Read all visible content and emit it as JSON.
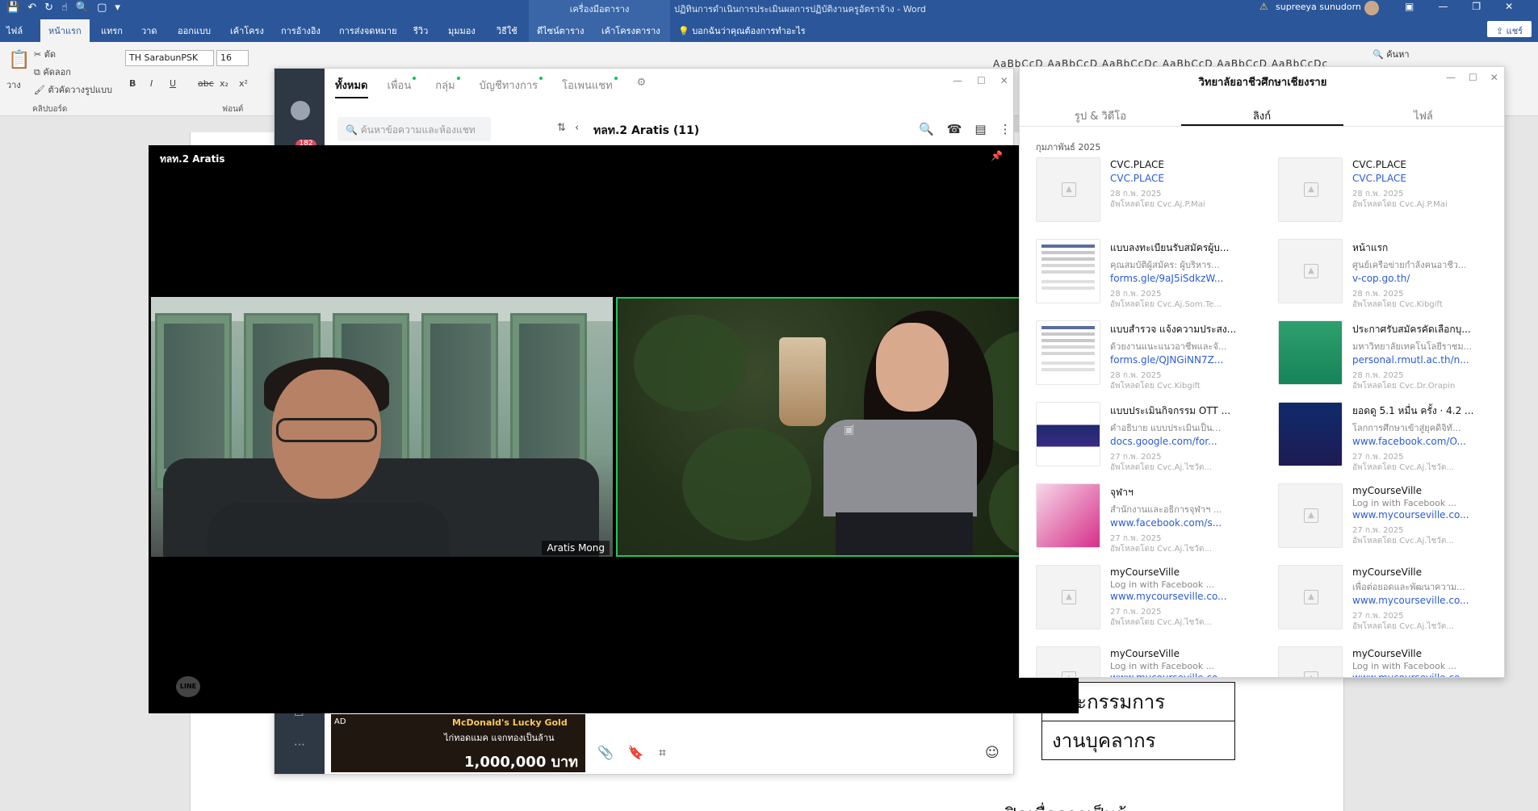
{
  "word": {
    "app_title": "ปฏิทินการดำเนินการประเมินผลการปฏิบัติงานครูอัตราจ้าง - Word",
    "table_tools": "เครื่องมือตาราง",
    "user": "supreeya sunudorn",
    "tabs": [
      "ไฟล์",
      "หน้าแรก",
      "แทรก",
      "วาด",
      "ออกแบบ",
      "เค้าโครง",
      "การอ้างอิง",
      "การส่งจดหมาย",
      "รีวิว",
      "มุมมอง",
      "วิธีใช้",
      "ดีไซน์ตาราง",
      "เค้าโครงตาราง"
    ],
    "tell_me": "บอกฉันว่าคุณต้องการทำอะไร",
    "share": "แชร์",
    "font_name": "TH SarabunPSK",
    "font_size": "16",
    "ribbon": {
      "paste": "วาง",
      "cut": "ตัด",
      "copy": "คัดลอก",
      "format_painter": "ตัวคัดวางรูปแบบ",
      "clipboard": "คลิปบอร์ด",
      "font_group": "ฟอนต์",
      "search": "ค้นหา",
      "styles_preview": "AaBbCcD  AaBbCcD  AaBbCcDc  AaBbCcD  AaBbCcD  AaBbCcDc"
    },
    "doc_table_rows": [
      "และกรรมการ",
      "งานบุคลากร"
    ],
    "doc_bottom_text": "ปิดเพื่อการเป็นผู้"
  },
  "line": {
    "tabs": [
      "ทั้งหมด",
      "เพื่อน",
      "กลุ่ม",
      "บัญชีทางการ",
      "โอเพนแชท"
    ],
    "search_placeholder": "ค้นหาข้อความและห้องแชท",
    "badge": "182",
    "chat_title": "ทลท.2 Aratis (11)",
    "ad": {
      "tag": "AD",
      "title": "McDonald's Lucky Gold",
      "subtitle": "ไก่ทอดแมค แจกทองเป็นล้าน",
      "amount": "1,000,000 บาท"
    }
  },
  "call": {
    "title": "ทลท.2 Aratis",
    "participant_name": "Aratis Mong",
    "logo": "LINE"
  },
  "group": {
    "title": "วิทยาลัยอาชีวศึกษาเชียงราย",
    "tabs": [
      "รูป & วิดีโอ",
      "ลิงก์",
      "ไฟล์"
    ],
    "month": "กุมภาพันธ์ 2025",
    "links": [
      {
        "title": "CVC.PLACE",
        "desc": "",
        "url": "CVC.PLACE",
        "date": "28 ก.พ. 2025",
        "by": "อัพโหลดโดย Cvc.Aj.P.Mai"
      },
      {
        "title": "CVC.PLACE",
        "desc": "",
        "url": "CVC.PLACE",
        "date": "28 ก.พ. 2025",
        "by": "อัพโหลดโดย Cvc.Aj.P.Mai"
      },
      {
        "title": "แบบลงทะเบียนรับสมัครผู้บ...",
        "desc": "คุณสมบัติผู้สมัคร: ผู้บริหาร...",
        "url": "forms.gle/9aJ5iSdkzW...",
        "date": "28 ก.พ. 2025",
        "by": "อัพโหลดโดย Cvc.Aj.Som.Te..."
      },
      {
        "title": "หน้าแรก",
        "desc": "ศูนย์เครือข่ายกำลังคนอาชีว...",
        "url": "v-cop.go.th/",
        "date": "28 ก.พ. 2025",
        "by": "อัพโหลดโดย Cvc.Kibgift"
      },
      {
        "title": "แบบสำรวจ แจ้งความประสง...",
        "desc": "ด้วยงานแนะแนวอาชีพและจั...",
        "url": "forms.gle/QJNGiNN7Z...",
        "date": "28 ก.พ. 2025",
        "by": "อัพโหลดโดย Cvc.Kibgift"
      },
      {
        "title": "ประกาศรับสมัครคัดเลือกบุ...",
        "desc": "มหาวิทยาลัยเทคโนโลยีราชม...",
        "url": "personal.rmutl.ac.th/n...",
        "date": "28 ก.พ. 2025",
        "by": "อัพโหลดโดย Cvc.Dr.Orapin"
      },
      {
        "title": "แบบประเมินกิจกรรม OTT ...",
        "desc": "คำอธิบาย แบบประเมินเป็น...",
        "url": "docs.google.com/for...",
        "date": "27 ก.พ. 2025",
        "by": "อัพโหลดโดย Cvc.Aj.ไชวัต..."
      },
      {
        "title": "ยอดดู 5.1 หมื่น ครั้ง · 4.2 ...",
        "desc": "โลกการศึกษาเข้าสู่ยุคดิจิทั...",
        "url": "www.facebook.com/O...",
        "date": "27 ก.พ. 2025",
        "by": "อัพโหลดโดย Cvc.Aj.ไชวัต..."
      },
      {
        "title": "จุฬาฯ",
        "desc": "สำนักงานและอธิการจุฬาฯ ...",
        "url": "www.facebook.com/s...",
        "date": "27 ก.พ. 2025",
        "by": "อัพโหลดโดย Cvc.Aj.ไชวัต..."
      },
      {
        "title": "myCourseVille",
        "desc": "Log in with Facebook ...",
        "url": "www.mycourseville.co...",
        "date": "27 ก.พ. 2025",
        "by": "อัพโหลดโดย Cvc.Aj.ไชวัต..."
      },
      {
        "title": "myCourseVille",
        "desc": "Log in with Facebook ...",
        "url": "www.mycourseville.co...",
        "date": "27 ก.พ. 2025",
        "by": "อัพโหลดโดย Cvc.Aj.ไชวัต..."
      },
      {
        "title": "myCourseVille",
        "desc": "เพื่อต่อยอดและพัฒนาความ...",
        "url": "www.mycourseville.co...",
        "date": "27 ก.พ. 2025",
        "by": "อัพโหลดโดย Cvc.Aj.ไชวัต..."
      },
      {
        "title": "myCourseVille",
        "desc": "Log in with Facebook ...",
        "url": "www.mycourseville.co...",
        "date": "",
        "by": ""
      },
      {
        "title": "myCourseVille",
        "desc": "Log in with Facebook ...",
        "url": "www.mycourseville.co...",
        "date": "",
        "by": ""
      }
    ]
  }
}
